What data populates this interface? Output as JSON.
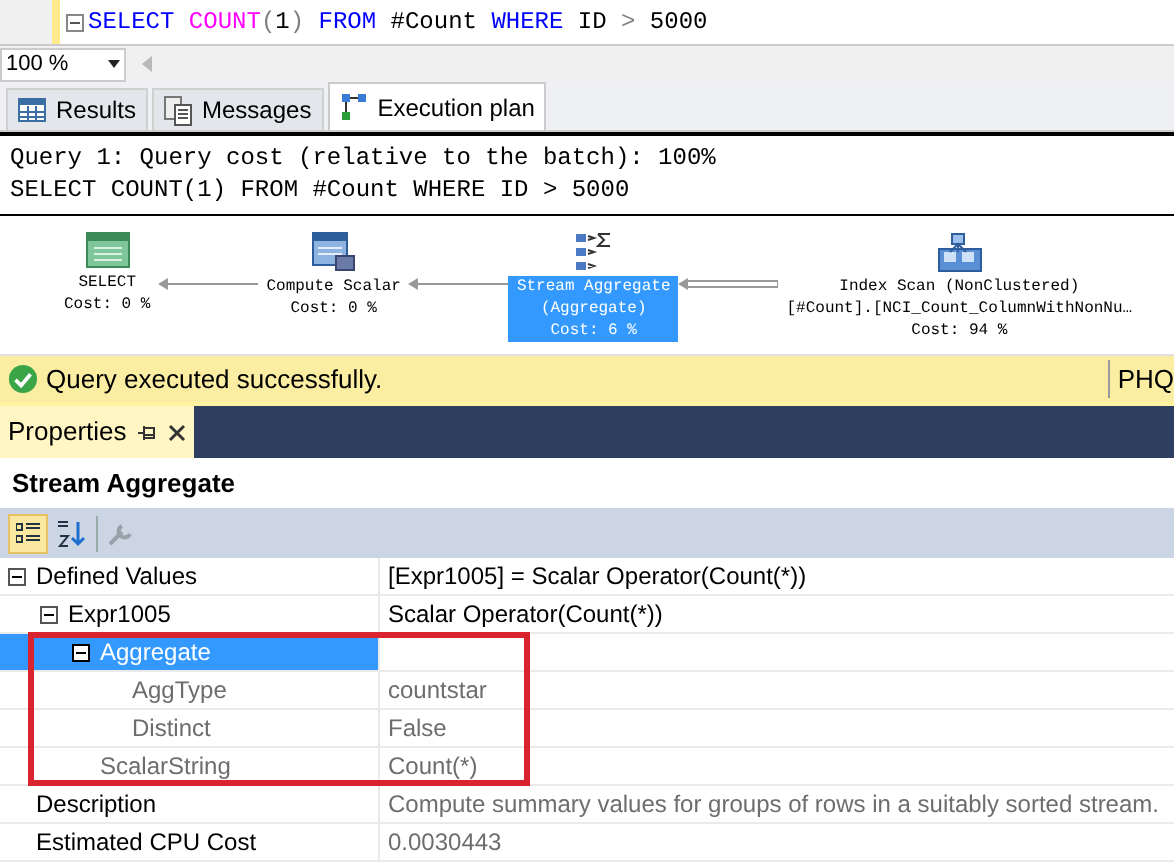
{
  "editor": {
    "tokens": [
      {
        "kind": "keyword",
        "text": "SELECT "
      },
      {
        "kind": "function",
        "text": "COUNT"
      },
      {
        "kind": "operator",
        "text": "("
      },
      {
        "kind": "plain",
        "text": "1"
      },
      {
        "kind": "operator",
        "text": ") "
      },
      {
        "kind": "keyword",
        "text": "FROM "
      },
      {
        "kind": "plain",
        "text": "#Count "
      },
      {
        "kind": "keyword",
        "text": "WHERE "
      },
      {
        "kind": "plain",
        "text": "ID "
      },
      {
        "kind": "operator",
        "text": "> "
      },
      {
        "kind": "plain",
        "text": "5000"
      }
    ]
  },
  "zoom": {
    "value": "100 %"
  },
  "tabs": [
    {
      "label": "Results",
      "kind": "grid",
      "selected": false
    },
    {
      "label": "Messages",
      "kind": "messages",
      "selected": false
    },
    {
      "label": "Execution plan",
      "kind": "plan",
      "selected": true
    }
  ],
  "plan": {
    "header": [
      "Query 1: Query cost (relative to the batch): 100%",
      "SELECT COUNT(1) FROM #Count WHERE ID > 5000"
    ],
    "nodes": [
      {
        "kind": "select",
        "lines": [
          "SELECT",
          "Cost: 0 %"
        ],
        "selected": false
      },
      {
        "kind": "compute",
        "lines": [
          "Compute Scalar",
          "Cost: 0 %"
        ],
        "selected": false
      },
      {
        "kind": "aggregate",
        "lines": [
          "Stream Aggregate",
          "(Aggregate)",
          "Cost: 6 %"
        ],
        "selected": true
      },
      {
        "kind": "scan",
        "lines": [
          "Index Scan (NonClustered)",
          "[#Count].[NCI_Count_ColumnWithNonNu…",
          "Cost: 94 %"
        ],
        "selected": false
      }
    ]
  },
  "status_bar": {
    "message": "Query executed successfully.",
    "server": "PHQ"
  },
  "properties": {
    "title": "Properties",
    "object": "Stream Aggregate",
    "rows": [
      {
        "name": "Defined Values",
        "value": "[Expr1005] = Scalar Operator(Count(*))",
        "expanded": true,
        "selected": false,
        "highlighted": false,
        "children": [
          {
            "name": "Expr1005",
            "value": "Scalar Operator(Count(*))",
            "expanded": true,
            "selected": false,
            "highlighted": false,
            "children": [
              {
                "name": "Aggregate",
                "expanded": true,
                "selected": true,
                "highlighted": true,
                "children": [
                  {
                    "name": "AggType",
                    "value": "countstar",
                    "selected": false,
                    "highlighted": true
                  },
                  {
                    "name": "Distinct",
                    "value": "False",
                    "selected": false,
                    "highlighted": true
                  }
                ]
              },
              {
                "name": "ScalarString",
                "value": "Count(*)",
                "selected": false,
                "highlighted": true
              }
            ]
          }
        ]
      },
      {
        "name": "Description",
        "value": "Compute summary values for groups of rows in a suitably sorted stream.",
        "selected": false,
        "highlighted": false
      },
      {
        "name": "Estimated CPU Cost",
        "value": "0.0030443",
        "selected": false,
        "highlighted": false
      }
    ]
  }
}
